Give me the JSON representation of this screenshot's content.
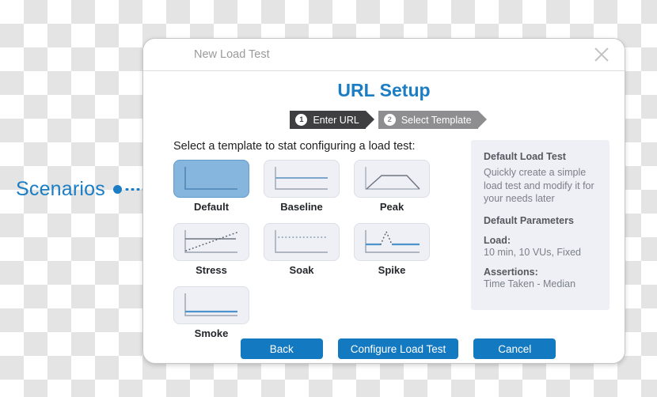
{
  "annotation": {
    "label": "Scenarios",
    "accent_color": "#1b7dc4"
  },
  "window": {
    "title": "New Load Test",
    "close_icon": "close-icon"
  },
  "dialog": {
    "heading": "URL Setup",
    "steps": [
      {
        "number": "1",
        "label": "Enter URL",
        "color": "#3f3f41",
        "state": "completed"
      },
      {
        "number": "2",
        "label": "Select Template",
        "color": "#8e8e90",
        "state": "current"
      }
    ],
    "prompt": "Select a template to stat configuring a load test:",
    "templates": [
      {
        "name": "Default",
        "thumb": "default-thumb",
        "selected": true
      },
      {
        "name": "Baseline",
        "thumb": "baseline-thumb",
        "selected": false
      },
      {
        "name": "Peak",
        "thumb": "peak-thumb",
        "selected": false
      },
      {
        "name": "Stress",
        "thumb": "stress-thumb",
        "selected": false
      },
      {
        "name": "Soak",
        "thumb": "soak-thumb",
        "selected": false
      },
      {
        "name": "Spike",
        "thumb": "spike-thumb",
        "selected": false
      },
      {
        "name": "Smoke",
        "thumb": "smoke-thumb",
        "selected": false
      }
    ],
    "info": {
      "title": "Default Load Test",
      "description": "Quickly create a simple load test and modify it for your needs later",
      "params_heading": "Default Parameters",
      "load_label": "Load:",
      "load_value": "10 min, 10  VUs, Fixed",
      "assertions_label": "Assertions:",
      "assertions_value": "Time Taken - Median"
    },
    "buttons": {
      "back": "Back",
      "configure": "Configure Load Test",
      "cancel": "Cancel"
    }
  }
}
